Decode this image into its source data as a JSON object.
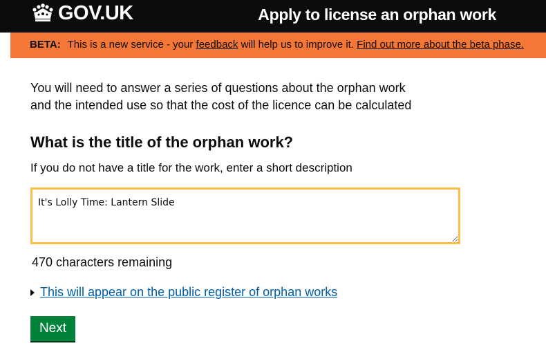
{
  "header": {
    "logo_text": "GOV.UK",
    "logo_icon": "crown-icon",
    "service_name": "Apply to license an orphan work"
  },
  "beta_banner": {
    "tag": "BETA:",
    "text_before": "This is a new service - your",
    "feedback_link": "feedback",
    "text_after": "will help us to improve it.",
    "more_link": "Find out more about the beta phase.",
    "color": "#f47738"
  },
  "main": {
    "intro_line1": "You will need to answer a series of questions about the orphan work",
    "intro_line2": "and the intended use so that the cost of the licence can be calculated",
    "question": "What is the title of the orphan work?",
    "hint": "If you do not have a title for the work, enter a short description",
    "title_value": "It's Lolly Time: Lantern Slide",
    "characters_remaining": "470 characters remaining",
    "details_link": "This will appear on the public register of orphan works",
    "next_label": "Next"
  },
  "colors": {
    "header_bg": "#0b0c0c",
    "focus": "#ffbf47",
    "link": "#005ea5",
    "button": "#00823b"
  }
}
